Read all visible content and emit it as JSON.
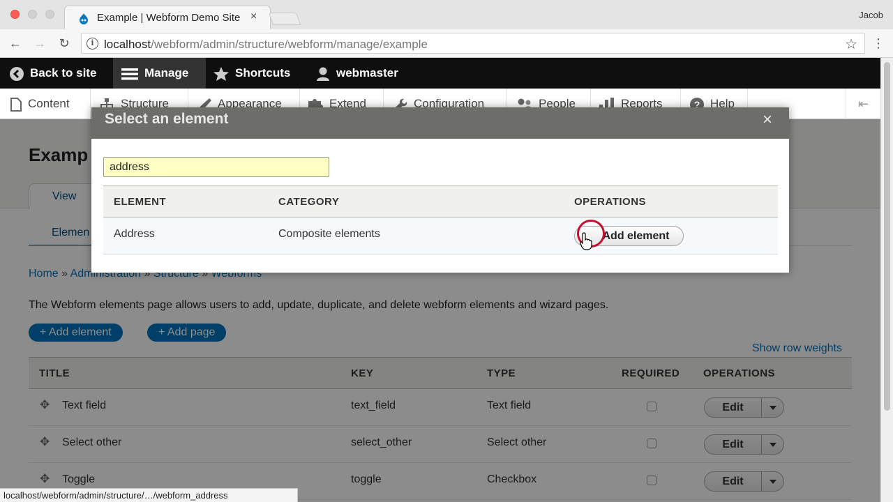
{
  "browser": {
    "tab_title": "Example | Webform Demo Site",
    "tab_close": "×",
    "profile_name": "Jacob",
    "url_host": "localhost",
    "url_path": "/webform/admin/structure/webform/manage/example",
    "status_url": "localhost/webform/admin/structure/…/webform_address"
  },
  "admin_toolbar": {
    "items": [
      {
        "label": "Back to site",
        "icon": "back-arrow-icon"
      },
      {
        "label": "Manage",
        "icon": "hamburger-icon"
      },
      {
        "label": "Shortcuts",
        "icon": "star-icon"
      },
      {
        "label": "webmaster",
        "icon": "user-icon"
      }
    ],
    "tray": [
      {
        "label": "Content",
        "icon": "document-icon"
      },
      {
        "label": "Structure",
        "icon": "sitemap-icon"
      },
      {
        "label": "Appearance",
        "icon": "paintbrush-icon"
      },
      {
        "label": "Extend",
        "icon": "puzzle-icon"
      },
      {
        "label": "Configuration",
        "icon": "wrench-icon"
      },
      {
        "label": "People",
        "icon": "people-icon"
      },
      {
        "label": "Reports",
        "icon": "bar-chart-icon"
      },
      {
        "label": "Help",
        "icon": "help-icon"
      }
    ]
  },
  "page": {
    "title": "Examp",
    "tab_view": "View",
    "subtab": "Elemen",
    "breadcrumb": [
      "Home",
      "Administration",
      "Structure",
      "Webforms"
    ],
    "breadcrumb_sep": "»",
    "description": "The Webform elements page allows users to add, update, duplicate, and delete webform elements and wizard pages.",
    "add_element": "+ Add element",
    "add_page": "+ Add page",
    "show_row_weights": "Show row weights",
    "table": {
      "headers": [
        "TITLE",
        "KEY",
        "TYPE",
        "REQUIRED",
        "OPERATIONS"
      ],
      "rows": [
        {
          "title": "Text field",
          "key": "text_field",
          "type": "Text field",
          "edit": "Edit"
        },
        {
          "title": "Select other",
          "key": "select_other",
          "type": "Select other",
          "edit": "Edit"
        },
        {
          "title": "Toggle",
          "key": "toggle",
          "type": "Checkbox",
          "edit": "Edit"
        }
      ]
    }
  },
  "dialog": {
    "title": "Select an element",
    "close": "×",
    "filter_value": "address",
    "headers": [
      "ELEMENT",
      "CATEGORY",
      "OPERATIONS"
    ],
    "rows": [
      {
        "element": "Address",
        "category": "Composite elements",
        "button": "Add element"
      }
    ]
  },
  "colors": {
    "admin_bar": "#0f0f0f",
    "link": "#0074bd",
    "filter_bg": "#ffffc4",
    "click_ring": "#c8102e"
  }
}
